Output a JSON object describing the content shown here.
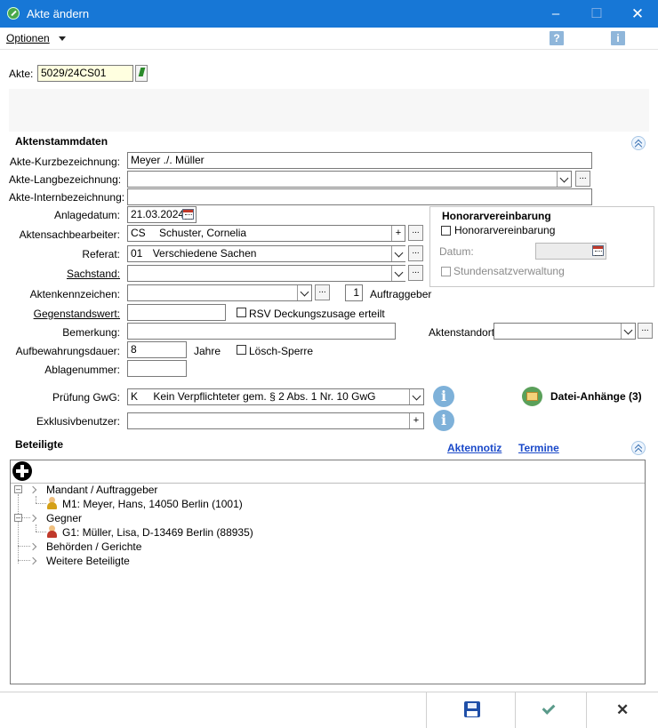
{
  "window": {
    "title": "Akte ändern"
  },
  "menu": {
    "options_label": "Optionen"
  },
  "help": {
    "question_glyph": "?",
    "info_glyph": "i"
  },
  "akte": {
    "label": "Akte:",
    "value": "5029/24CS01"
  },
  "aktenstammdaten": {
    "section_title": "Aktenstammdaten",
    "kurzbezeichnung_label": "Akte-Kurzbezeichnung:",
    "kurzbezeichnung_value": "Meyer ./. Müller",
    "langbezeichnung_label": "Akte-Langbezeichnung:",
    "langbezeichnung_value": "",
    "internbezeichnung_label": "Akte-Internbezeichnung:",
    "internbezeichnung_value": "",
    "anlagedatum_label": "Anlagedatum:",
    "anlagedatum_value": "21.03.2024",
    "sachbearbeiter_label": "Aktensachbearbeiter:",
    "sachbearbeiter_code": "CS",
    "sachbearbeiter_name": "Schuster, Cornelia",
    "referat_label": "Referat:",
    "referat_code": "01",
    "referat_name": "Verschiedene Sachen",
    "sachstand_label": "Sachstand:",
    "sachstand_value": "",
    "aktenkennzeichen_label": "Aktenkennzeichen:",
    "aktenkennzeichen_value": "",
    "auftraggeber_count": "1",
    "auftraggeber_label": "Auftraggeber",
    "gegenstandswert_label": "Gegenstandswert:",
    "gegenstandswert_value": "",
    "rsv_label": "RSV Deckungszusage erteilt",
    "bemerkung_label": "Bemerkung:",
    "bemerkung_value": "",
    "aktenstandort_label": "Aktenstandort:",
    "aktenstandort_value": "",
    "aufbewahrung_label": "Aufbewahrungsdauer:",
    "aufbewahrung_value": "8",
    "aufbewahrung_unit": "Jahre",
    "loeschsperre_label": "Lösch-Sperre",
    "ablagenummer_label": "Ablagenummer:",
    "ablagenummer_value": "",
    "gwg_label": "Prüfung GwG:",
    "gwg_code": "K",
    "gwg_text": "Kein Verpflichteter gem. § 2 Abs. 1 Nr. 10 GwG",
    "exklusiv_label": "Exklusivbenutzer:",
    "exklusiv_value": "",
    "datei_anhaenge_label": "Datei-Anhänge (3)",
    "ellipsis": "...",
    "plus": "+"
  },
  "honorar": {
    "group_title": "Honorarvereinbarung",
    "checkbox_label": "Honorarvereinbarung",
    "datum_label": "Datum:",
    "datum_value": "",
    "stundensatz_label": "Stundensatzverwaltung"
  },
  "beteiligte": {
    "section_title": "Beteiligte",
    "aktennotiz_link": "Aktennotiz",
    "termine_link": "Termine",
    "tree": [
      {
        "label": "Mandant / Auftraggeber",
        "children": [
          "M1: Meyer, Hans, 14050 Berlin (1001)"
        ]
      },
      {
        "label": "Gegner",
        "children": [
          "G1: Müller, Lisa, D-13469 Berlin (88935)"
        ]
      },
      {
        "label": "Behörden / Gerichte",
        "children": []
      },
      {
        "label": "Weitere Beteiligte",
        "children": []
      }
    ]
  },
  "colors": {
    "titlebar": "#1777d6",
    "akte_field_bg": "#ffffe0",
    "link": "#1a49c9",
    "mandant_person": "#d4a017",
    "gegner_person": "#c0392b"
  },
  "footer": {
    "save_icon": "floppy-disk-icon",
    "ok_icon": "checkmark-icon",
    "cancel_icon": "close-icon"
  }
}
